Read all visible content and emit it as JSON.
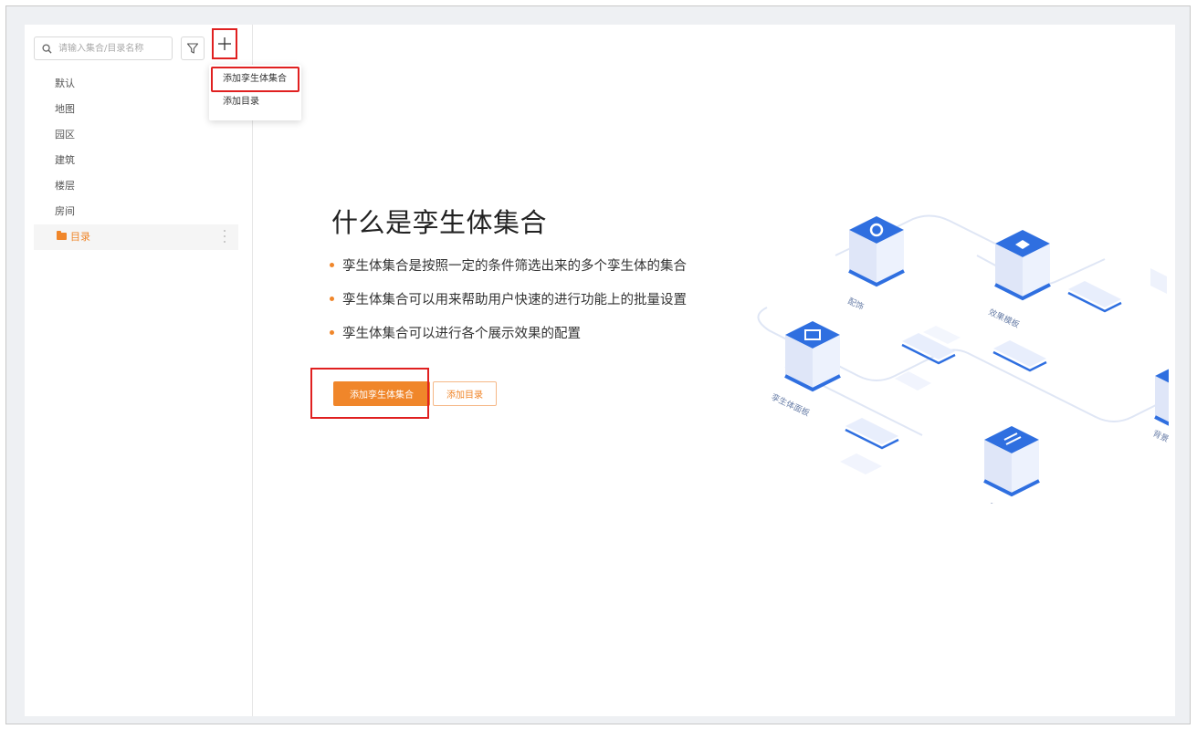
{
  "sidebar": {
    "search_placeholder": "请输入集合/目录名称",
    "items": [
      {
        "label": "默认"
      },
      {
        "label": "地图"
      },
      {
        "label": "园区"
      },
      {
        "label": "建筑"
      },
      {
        "label": "楼层"
      },
      {
        "label": "房间"
      },
      {
        "label": "目录",
        "active": true
      }
    ]
  },
  "dropdown": {
    "items": [
      {
        "label": "添加孪生体集合"
      },
      {
        "label": "添加目录"
      }
    ]
  },
  "main": {
    "title": "什么是孪生体集合",
    "bullets": [
      "孪生体集合是按照一定的条件筛选出来的多个孪生体的集合",
      "孪生体集合可以用来帮助用户快速的进行功能上的批量设置",
      "孪生体集合可以进行各个展示效果的配置"
    ],
    "primary_button": "添加孪生体集合",
    "secondary_button": "添加目录"
  },
  "illustration": {
    "labels": [
      "配饰",
      "效果模板",
      "孪生体面板",
      "事件",
      "背景"
    ]
  },
  "colors": {
    "accent": "#f0862a",
    "highlight": "#e02020",
    "cube_top": "#2f6fe0",
    "cube_side": "#e9eefb"
  }
}
